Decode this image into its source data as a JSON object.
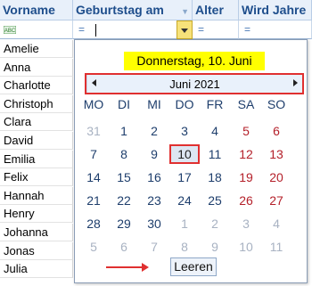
{
  "grid": {
    "columns": [
      {
        "key": "vorname",
        "label": "Vorname"
      },
      {
        "key": "geburtstag",
        "label": "Geburtstag am"
      },
      {
        "key": "alter",
        "label": "Alter"
      },
      {
        "key": "wird_jahre",
        "label": "Wird Jahre"
      }
    ],
    "filter": {
      "eq": "="
    },
    "rows": [
      "Amelie",
      "Anna",
      "Charlotte",
      "Christoph",
      "Clara",
      "David",
      "Emilia",
      "Felix",
      "Hannah",
      "Henry",
      "Johanna",
      "Jonas",
      "Julia"
    ]
  },
  "calendar": {
    "today_label": "Donnerstag, 10. Juni 2021",
    "month_label": "Juni 2021",
    "weekdays": [
      "MO",
      "DI",
      "MI",
      "DO",
      "FR",
      "SA",
      "SO"
    ],
    "weeks": [
      [
        "31",
        "1",
        "2",
        "3",
        "4",
        "5",
        "6"
      ],
      [
        "7",
        "8",
        "9",
        "10",
        "11",
        "12",
        "13"
      ],
      [
        "14",
        "15",
        "16",
        "17",
        "18",
        "19",
        "20"
      ],
      [
        "21",
        "22",
        "23",
        "24",
        "25",
        "26",
        "27"
      ],
      [
        "28",
        "29",
        "30",
        "1",
        "2",
        "3",
        "4"
      ],
      [
        "5",
        "6",
        "7",
        "8",
        "9",
        "10",
        "11"
      ]
    ],
    "selected_day": "10",
    "clear_label": "Leeren"
  },
  "colors": {
    "today_bg": "#ffff00",
    "highlight": "#e03030",
    "weekend": "#b4202a",
    "header_text": "#1e4e8c"
  },
  "icons": {
    "filter_type": "abc-icon",
    "dropdown": "chevron-down-icon",
    "filter": "funnel-icon"
  }
}
